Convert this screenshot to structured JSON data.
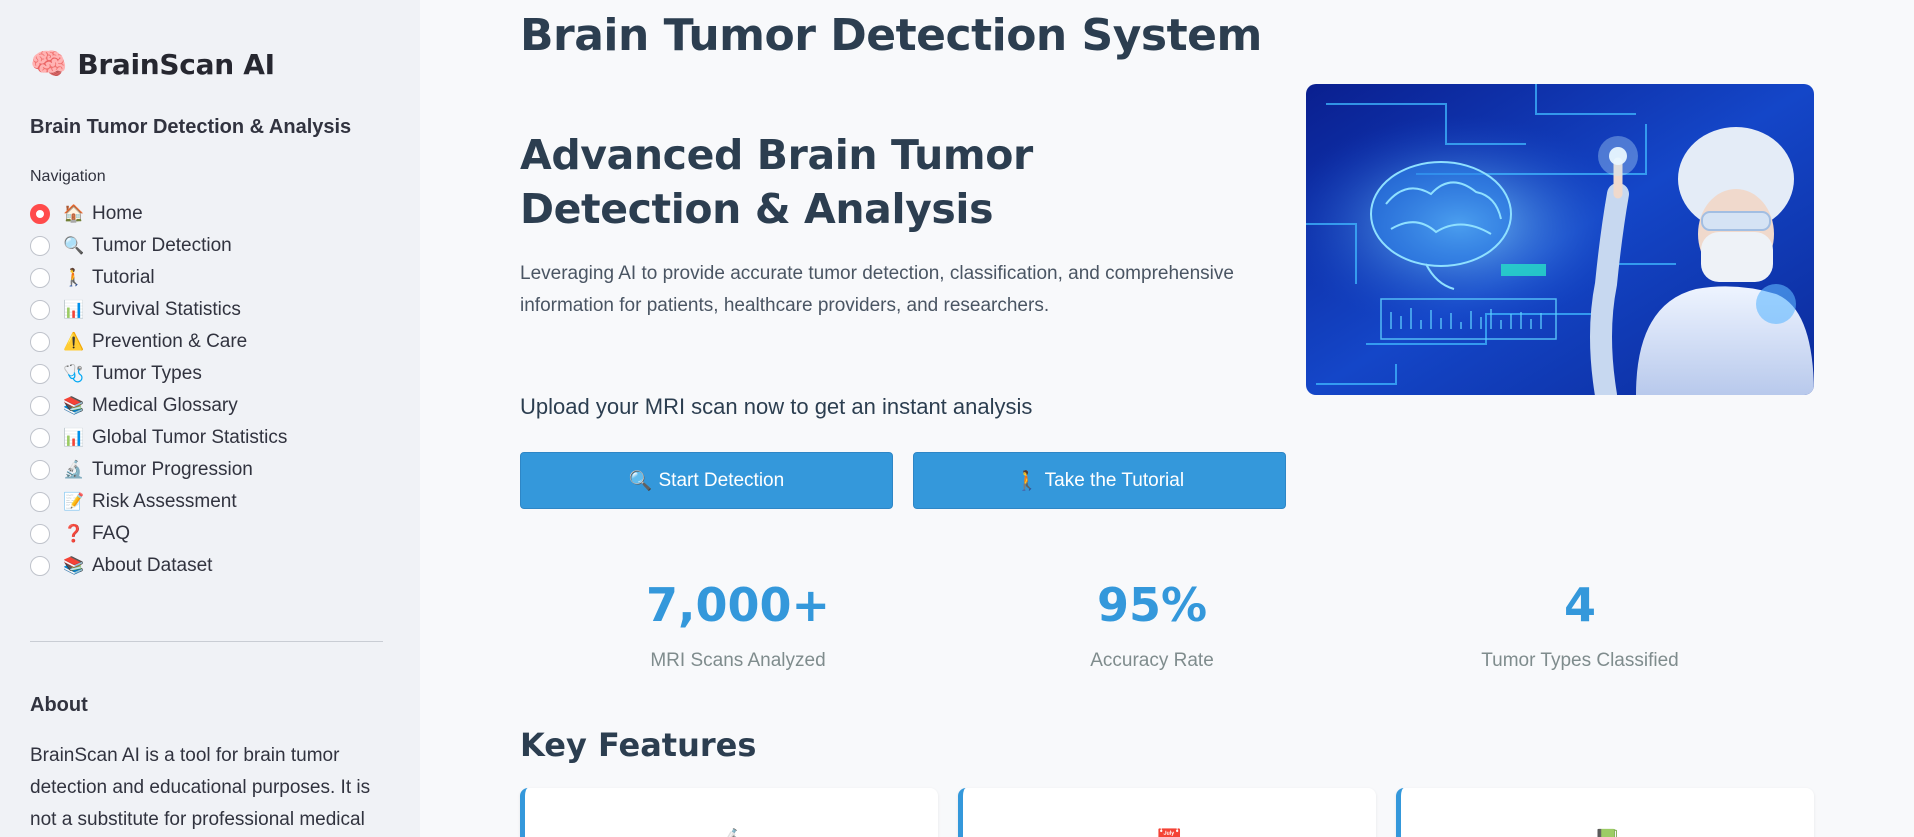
{
  "sidebar": {
    "brand_emoji": "🧠",
    "brand_title": "BrainScan AI",
    "subtitle": "Brain Tumor Detection & Analysis",
    "nav_label": "Navigation",
    "items": [
      {
        "icon": "🏠",
        "label": "Home",
        "selected": true
      },
      {
        "icon": "🔍",
        "label": "Tumor Detection"
      },
      {
        "icon": "🚶",
        "label": "Tutorial"
      },
      {
        "icon": "📊",
        "label": "Survival Statistics"
      },
      {
        "icon": "⚠️",
        "label": "Prevention & Care"
      },
      {
        "icon": "🩺",
        "label": "Tumor Types"
      },
      {
        "icon": "📚",
        "label": "Medical Glossary"
      },
      {
        "icon": "📊",
        "label": "Global Tumor Statistics"
      },
      {
        "icon": "🔬",
        "label": "Tumor Progression"
      },
      {
        "icon": "📝",
        "label": "Risk Assessment"
      },
      {
        "icon": "❓",
        "label": "FAQ"
      },
      {
        "icon": "📚",
        "label": "About Dataset"
      }
    ],
    "about_title": "About",
    "about_text": "BrainScan AI is a tool for brain tumor detection and educational purposes. It is not a substitute for professional medical"
  },
  "main": {
    "page_title": "Brain Tumor Detection System",
    "hero_title": "Advanced Brain Tumor Detection & Analysis",
    "hero_desc": "Leveraging AI to provide accurate tumor detection, classification, and comprehensive information for patients, healthcare providers, and researchers.",
    "upload_cta": "Upload your MRI scan now to get an instant analysis",
    "buttons": {
      "detect_icon": "🔍",
      "detect_label": "Start Detection",
      "tutorial_icon": "🚶",
      "tutorial_label": "Take the Tutorial"
    },
    "stats": [
      {
        "value": "7,000+",
        "label": "MRI Scans Analyzed"
      },
      {
        "value": "95%",
        "label": "Accuracy Rate"
      },
      {
        "value": "4",
        "label": "Tumor Types Classified"
      }
    ],
    "features_title": "Key Features",
    "feature_cards": [
      {
        "icon": "🔬"
      },
      {
        "icon": "📅"
      },
      {
        "icon": "📗"
      }
    ]
  },
  "colors": {
    "accent": "#3498db",
    "radio_selected": "#ff4b4b",
    "heading": "#2c3e50",
    "sidebar_bg": "#f0f2f6"
  }
}
